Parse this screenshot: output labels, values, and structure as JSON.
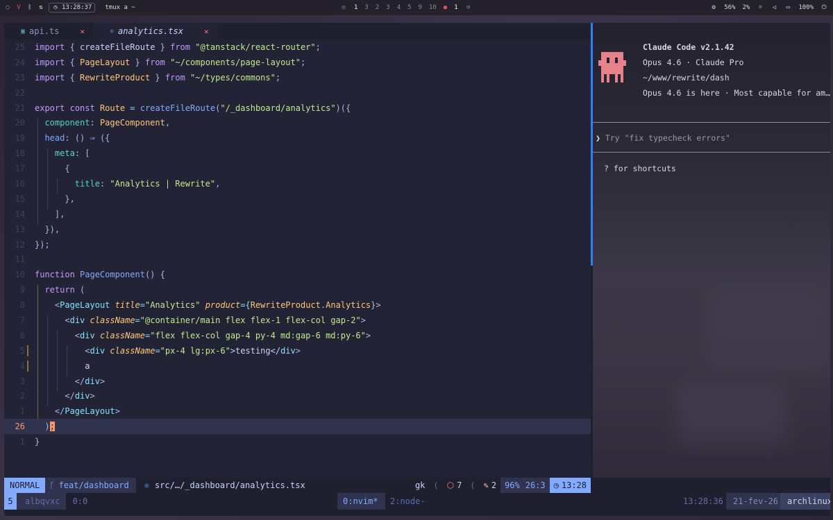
{
  "topbar": {
    "clock": "13:28:37",
    "tmux_title": "tmux a ~",
    "workspaces": [
      "1",
      "3",
      "2",
      "3",
      "4",
      "5",
      "9",
      "10",
      "1"
    ],
    "cpu": "56%",
    "mem": "2%",
    "battery": "100%"
  },
  "tabs": [
    {
      "label": "api.ts",
      "close": "✕"
    },
    {
      "label": "analytics.tsx",
      "close": "✕"
    }
  ],
  "code_lines": [
    {
      "ln": "25"
    },
    {
      "ln": "24"
    },
    {
      "ln": "23"
    },
    {
      "ln": "22"
    },
    {
      "ln": "21"
    },
    {
      "ln": "20"
    },
    {
      "ln": "19"
    },
    {
      "ln": "18"
    },
    {
      "ln": "17"
    },
    {
      "ln": "16"
    },
    {
      "ln": "15"
    },
    {
      "ln": "14"
    },
    {
      "ln": "13"
    },
    {
      "ln": "12"
    },
    {
      "ln": "11"
    },
    {
      "ln": "10"
    },
    {
      "ln": "9"
    },
    {
      "ln": "8"
    },
    {
      "ln": "7"
    },
    {
      "ln": "6"
    },
    {
      "ln": "5"
    },
    {
      "ln": "4"
    },
    {
      "ln": "3"
    },
    {
      "ln": "2"
    },
    {
      "ln": "1"
    },
    {
      "ln": "26"
    },
    {
      "ln": "1"
    }
  ],
  "code": {
    "l1": [
      "import",
      " { ",
      "createFileRoute",
      " } ",
      "from",
      " ",
      "\"@tanstack/react-router\"",
      ";"
    ],
    "l2": [
      "import",
      " { ",
      "PageLayout",
      " } ",
      "from",
      " ",
      "\"~/components/page-layout\"",
      ";"
    ],
    "l3": [
      "import",
      " { ",
      "RewriteProduct",
      " } ",
      "from",
      " ",
      "\"~/types/commons\"",
      ";"
    ],
    "l5": [
      "export",
      " ",
      "const",
      " ",
      "Route",
      " = ",
      "createFileRoute",
      "(",
      "\"/_dashboard/analytics\"",
      ")({"
    ],
    "l6": [
      "component",
      ": ",
      "PageComponent",
      ","
    ],
    "l7": [
      "head",
      ": () ",
      "⇒",
      " ({"
    ],
    "l8": [
      "meta",
      ": ["
    ],
    "l9": [
      "{"
    ],
    "l10": [
      "title",
      ": ",
      "\"Analytics | Rewrite\"",
      ","
    ],
    "l11": [
      "},"
    ],
    "l12": [
      "],"
    ],
    "l13": [
      "}),"
    ],
    "l14": [
      "});"
    ],
    "l16": [
      "function",
      " ",
      "PageComponent",
      "() {"
    ],
    "l17": [
      "return",
      " ("
    ],
    "l18": [
      "<",
      "PageLayout",
      " ",
      "title",
      "=",
      "\"Analytics\"",
      " ",
      "product",
      "={",
      "RewriteProduct",
      ".",
      "Analytics",
      "}>"
    ],
    "l19": [
      "<",
      "div",
      " ",
      "className",
      "=",
      "\"@container/main flex flex-1 flex-col gap-2\"",
      ">"
    ],
    "l20": [
      "<",
      "div",
      " ",
      "className",
      "=",
      "\"flex flex-col gap-4 py-4 md:gap-6 md:py-6\"",
      ">"
    ],
    "l21": [
      "<",
      "div",
      " ",
      "className",
      "=",
      "\"px-4 lg:px-6\"",
      ">testing</",
      "div",
      ">"
    ],
    "l22": [
      "a"
    ],
    "l23": [
      "</",
      "div",
      ">"
    ],
    "l24": [
      "</",
      "div",
      ">"
    ],
    "l25": [
      "</",
      "PageLayout",
      ">"
    ],
    "l26": [
      ")",
      ";"
    ],
    "l27": [
      "}"
    ]
  },
  "claude": {
    "title": "Claude Code v2.1.42",
    "plan": "Opus 4.6 · Claude Pro",
    "cwd": "~/www/rewrite/dash",
    "news": "Opus 4.6 is here · Most capable for am…",
    "prompt_caret": "❯",
    "prompt_placeholder": "Try \"fix typecheck errors\"",
    "hint": "? for shortcuts",
    "mascot_color": "#e8828a"
  },
  "statusline": {
    "mode": "NORMAL",
    "branch": "feat/dashboard",
    "file": "src/…/_dashboard/analytics.tsx",
    "gk": "gk",
    "diag_a": "7",
    "diag_b": "2",
    "percent": "96%",
    "position": "26:3",
    "time": "13:28"
  },
  "tmux": {
    "session": "5",
    "host": "albqvxc",
    "pane": "0:0",
    "win_active": "0:nvim*",
    "win_other": "2:node-",
    "time": "13:28:36",
    "date": "21-fev-26",
    "hostname": "archlinux"
  },
  "colors": {
    "accent": "#82aaff",
    "border": "#2b82f5",
    "cursor": "#ff966c"
  }
}
